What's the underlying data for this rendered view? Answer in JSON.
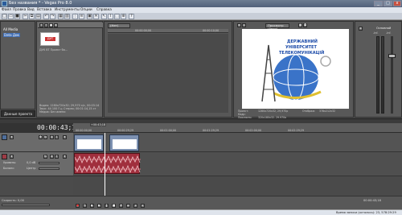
{
  "window": {
    "title": "Без названия * - Vegas Pro 8.0"
  },
  "menu": [
    "Файл",
    "Правка",
    "Вид",
    "Вставка",
    "Инструменты",
    "Опции",
    "Справка"
  ],
  "explorer": {
    "items": [
      "All Media",
      "Data Дов"
    ],
    "tab": "Данные проекта"
  },
  "media": {
    "thumb_label": "ДУК ВТ Проект ба...",
    "thumb_logo": "ДУТ",
    "info": [
      "Видео: 1280x720x32; 29,970 к/с, 00:03:14",
      "Звук: 44 100 Гц; Стерео; 00:01:14,15 ст",
      "Медиа: Без имени"
    ]
  },
  "trimmer": {
    "dropdown": "(Нет)",
    "time_left": "00:00:00;00",
    "time_right": "00:00:10;00"
  },
  "preview": {
    "dropdown": "Просмотр (Авто)",
    "logo_lines": [
      "ДЕРЖАВНИЙ",
      "УНІВЕРСИТЕТ",
      "ТЕЛЕКОМУНІКАЦІЙ"
    ],
    "info": [
      "Проект:",
      "1280x720x32, 29,970p",
      "Кадр:",
      "Просмотр:",
      "320x180x32, 29,970p",
      "Отображ:",
      "378x212x32"
    ]
  },
  "mixer": {
    "label": "Основной",
    "values": [
      "-Inf.",
      "-Inf."
    ]
  },
  "timeline": {
    "time": "00:00:43;18",
    "marker": "+00:43;18",
    "ruler": [
      "00:00:00;00",
      "00:00:29;29",
      "00:01:00;00",
      "00:01:29;29",
      "00:02:00;00",
      "00:02:29;29"
    ],
    "track_labels": {
      "level": "Уровень:",
      "volume_value": "0,0 dB",
      "pan": "Баланс:",
      "pan_value": "Центр"
    }
  },
  "transport": {
    "rate": "Скорость: 0,00",
    "time_right": "00:00:43;18"
  },
  "status": {
    "text": "Время записи (осталось): 23, 578:29:29"
  },
  "colors": {
    "audio": "#a02f3d",
    "video": "#5f7fb0",
    "bg": "#4b4b4b"
  }
}
